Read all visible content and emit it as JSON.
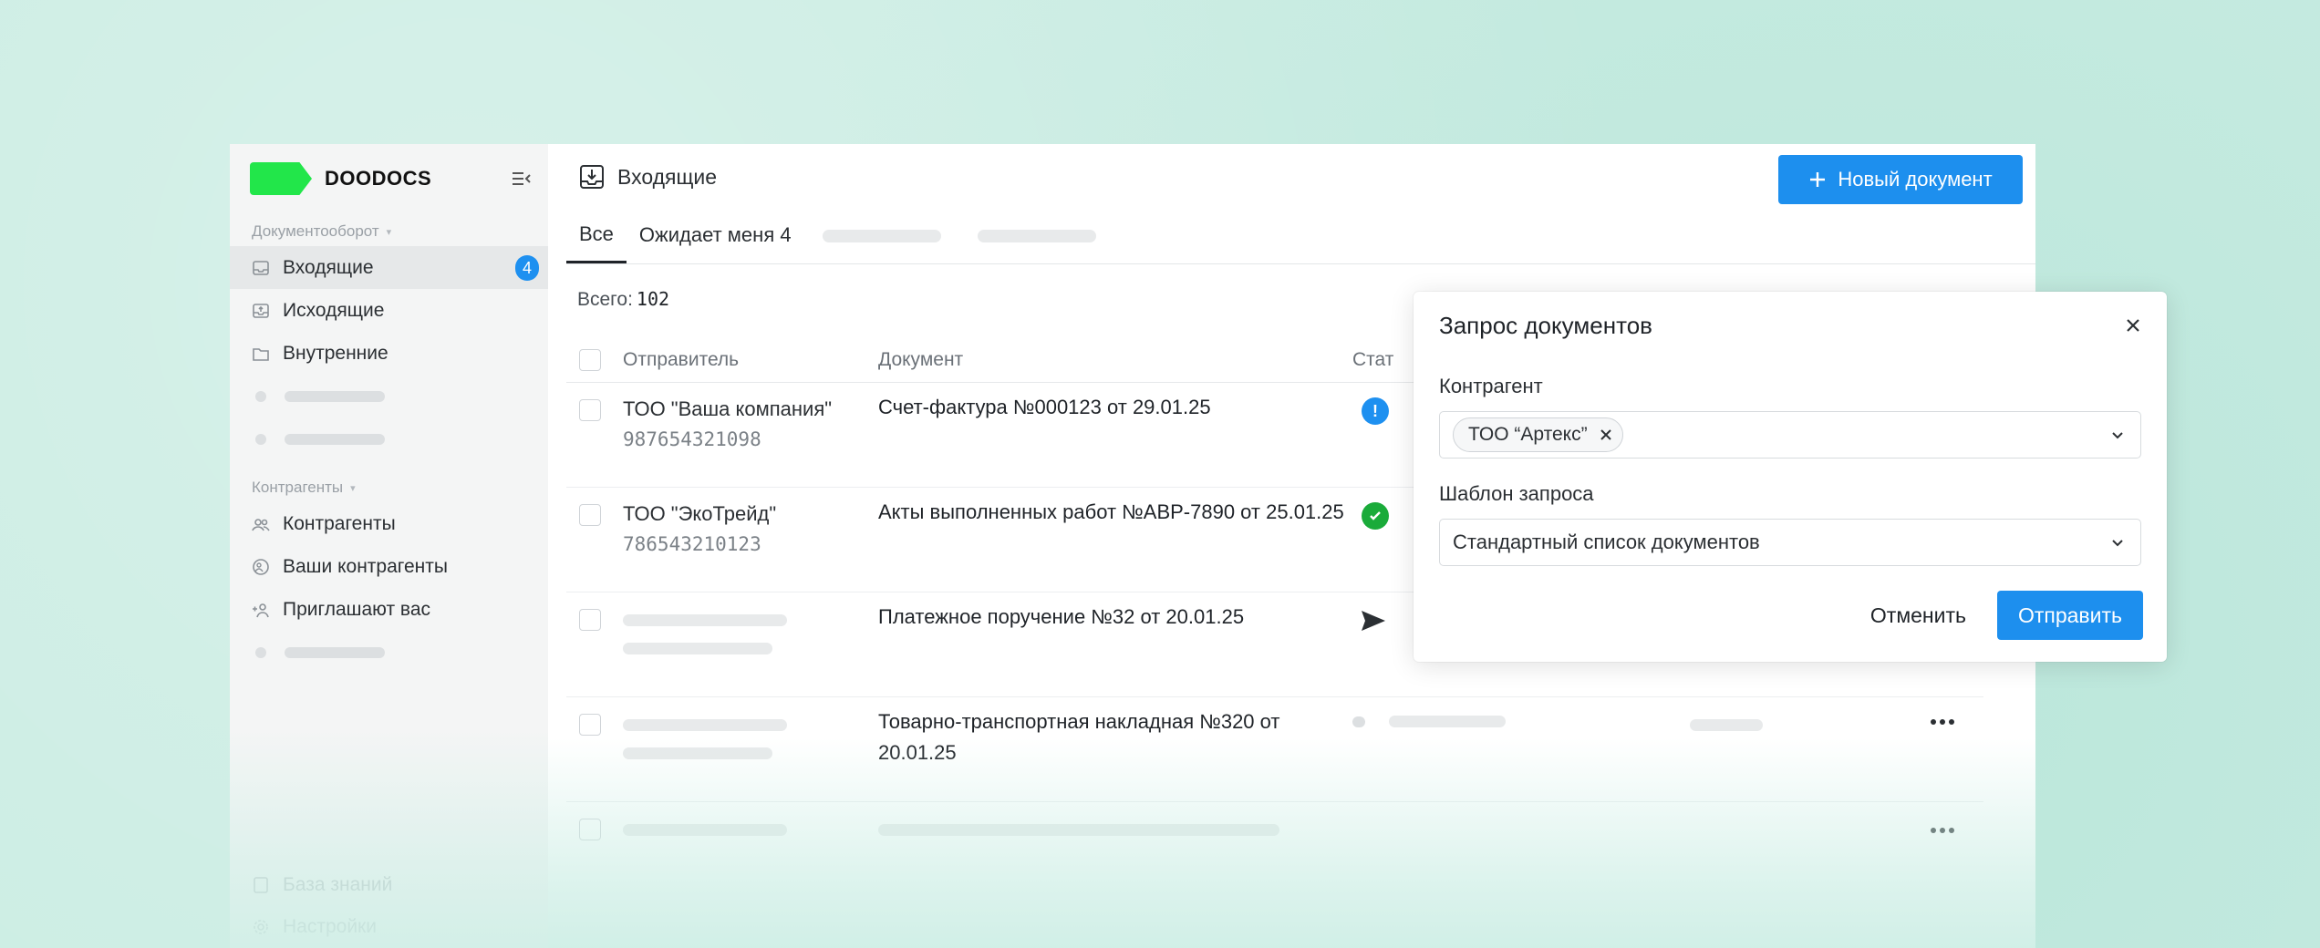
{
  "brand": {
    "name": "DOODOCS",
    "accent": "#22e64a"
  },
  "sidebar": {
    "section1": "Документооборот",
    "items": [
      {
        "label": "Входящие",
        "badge": "4",
        "icon": "inbox-icon"
      },
      {
        "label": "Исходящие",
        "icon": "outbox-icon"
      },
      {
        "label": "Внутренние",
        "icon": "folder-icon"
      }
    ],
    "section2": "Контрагенты",
    "items2": [
      {
        "label": "Контрагенты",
        "icon": "users-icon"
      },
      {
        "label": "Ваши контрагенты",
        "icon": "partners-icon"
      },
      {
        "label": "Приглашают вас",
        "icon": "invite-icon"
      }
    ],
    "bottom": [
      {
        "label": "База знаний",
        "icon": "book-icon"
      },
      {
        "label": "Настройки",
        "icon": "gear-icon"
      }
    ]
  },
  "header": {
    "title": "Входящие",
    "new_doc_label": "Новый документ"
  },
  "tabs": [
    {
      "label": "Все"
    },
    {
      "label": "Ожидает меня 4"
    }
  ],
  "total": {
    "label": "Всего:",
    "value": "102"
  },
  "table": {
    "columns": [
      "Отправитель",
      "Документ",
      "Стат"
    ],
    "rows": [
      {
        "sender": "ТОО \"Ваша компания\"",
        "inn": "987654321098",
        "doc": "Счет-фактура №000123 от 29.01.25",
        "status": "info"
      },
      {
        "sender": "ТОО \"ЭкоТрейд\"",
        "inn": "786543210123",
        "doc": "Акты выполненных работ №АВР-7890 от 25.01.25",
        "status": "ok"
      },
      {
        "sender": "",
        "inn": "",
        "doc": "Платежное поручение №32 от 20.01.25",
        "status": "sent"
      },
      {
        "sender": "",
        "inn": "",
        "doc": "Товарно-транспортная накладная №320 от 20.01.25",
        "status": ""
      }
    ]
  },
  "modal": {
    "title": "Запрос документов",
    "counterparty_label": "Контрагент",
    "counterparty_chip": "ТОО “Артекс”",
    "template_label": "Шаблон запроса",
    "template_value": "Стандартный список документов",
    "cancel_label": "Отменить",
    "send_label": "Отправить"
  },
  "colors": {
    "primary": "#1d8fee",
    "success": "#1aab3a",
    "background": "#cdeee5"
  }
}
